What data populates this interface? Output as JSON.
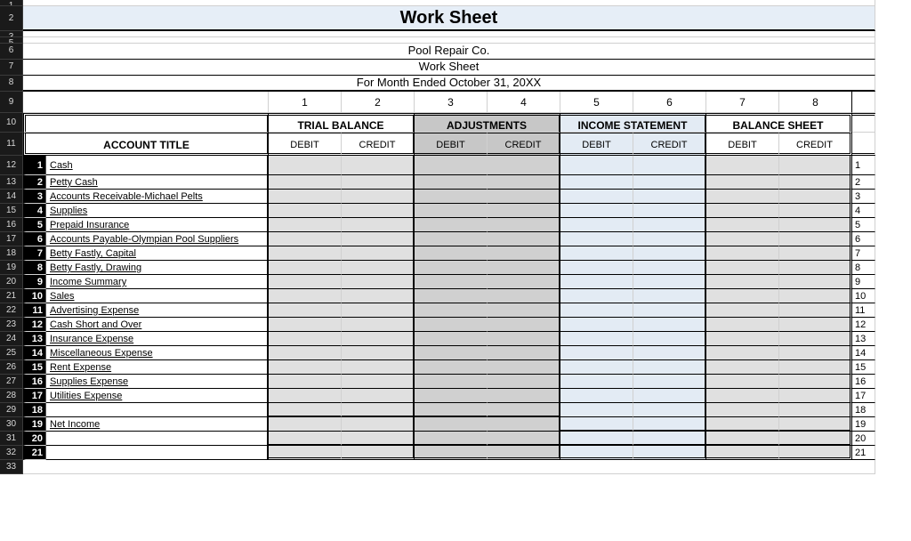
{
  "title": "Work Sheet",
  "header": {
    "company": "Pool Repair Co.",
    "doc": "Work Sheet",
    "period": "For Month Ended October 31, 20XX"
  },
  "col_numbers": [
    "1",
    "2",
    "3",
    "4",
    "5",
    "6",
    "7",
    "8"
  ],
  "groups": {
    "trial": "TRIAL BALANCE",
    "adj": "ADJUSTMENTS",
    "inc": "INCOME STATEMENT",
    "bal": "BALANCE SHEET"
  },
  "sub": {
    "debit": "DEBIT",
    "credit": "CREDIT"
  },
  "account_title_hdr": "ACCOUNT TITLE",
  "rows": [
    {
      "n": "1",
      "title": "Cash"
    },
    {
      "n": "2",
      "title": "Petty Cash"
    },
    {
      "n": "3",
      "title": "Accounts Receivable-Michael Pelts"
    },
    {
      "n": "4",
      "title": "Supplies"
    },
    {
      "n": "5",
      "title": "Prepaid Insurance"
    },
    {
      "n": "6",
      "title": "Accounts Payable-Olympian Pool Suppliers"
    },
    {
      "n": "7",
      "title": "Betty Fastly, Capital"
    },
    {
      "n": "8",
      "title": "Betty Fastly, Drawing"
    },
    {
      "n": "9",
      "title": "Income Summary"
    },
    {
      "n": "10",
      "title": "Sales"
    },
    {
      "n": "11",
      "title": "Advertising Expense"
    },
    {
      "n": "12",
      "title": "Cash Short and Over"
    },
    {
      "n": "13",
      "title": "Insurance Expense"
    },
    {
      "n": "14",
      "title": "Miscellaneous Expense"
    },
    {
      "n": "15",
      "title": "Rent Expense"
    },
    {
      "n": "16",
      "title": "Supplies Expense"
    },
    {
      "n": "17",
      "title": "Utilities Expense"
    },
    {
      "n": "18",
      "title": ""
    },
    {
      "n": "19",
      "title": "Net Income"
    },
    {
      "n": "20",
      "title": ""
    },
    {
      "n": "21",
      "title": ""
    }
  ],
  "excel_rows": [
    "1",
    "2",
    "3",
    "5",
    "6",
    "7",
    "8",
    "9",
    "10",
    "11",
    "12",
    "13",
    "14",
    "15",
    "16",
    "17",
    "18",
    "19",
    "20",
    "21",
    "22",
    "23",
    "24",
    "25",
    "26",
    "27",
    "28",
    "29",
    "30",
    "31",
    "32",
    "33"
  ]
}
